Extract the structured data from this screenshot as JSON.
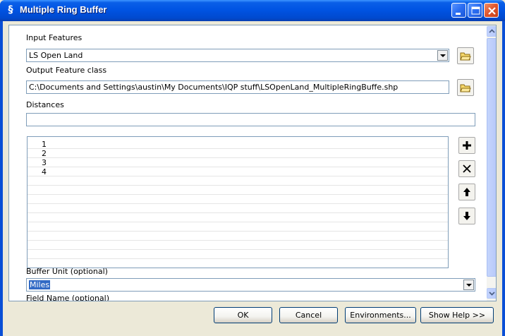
{
  "window": {
    "title": "Multiple Ring Buffer",
    "icon_name": "gp-tool-icon"
  },
  "form": {
    "input_features_label": "Input Features",
    "input_features_value": "LS Open Land",
    "output_label": "Output Feature class",
    "output_value": "C:\\Documents and Settings\\austin\\My Documents\\IQP stuff\\LSOpenLand_MultipleRingBuffe.shp",
    "distances_label": "Distances",
    "distances_input_value": "",
    "distances_list": [
      "1",
      "2",
      "3",
      "4"
    ],
    "buffer_unit_label": "Buffer Unit (optional)",
    "buffer_unit_value": "Miles",
    "field_name_label": "Field Name (optional)"
  },
  "side_buttons": {
    "add_icon": "plus-icon",
    "remove_icon": "x-icon",
    "up_icon": "arrow-up-icon",
    "down_icon": "arrow-down-icon"
  },
  "buttons": {
    "ok": "OK",
    "cancel": "Cancel",
    "environments": "Environments...",
    "help": "Show Help >>"
  },
  "colors": {
    "titlebar": "#0054e3",
    "dialog_bg": "#ece9d8",
    "selection": "#316ac5"
  }
}
